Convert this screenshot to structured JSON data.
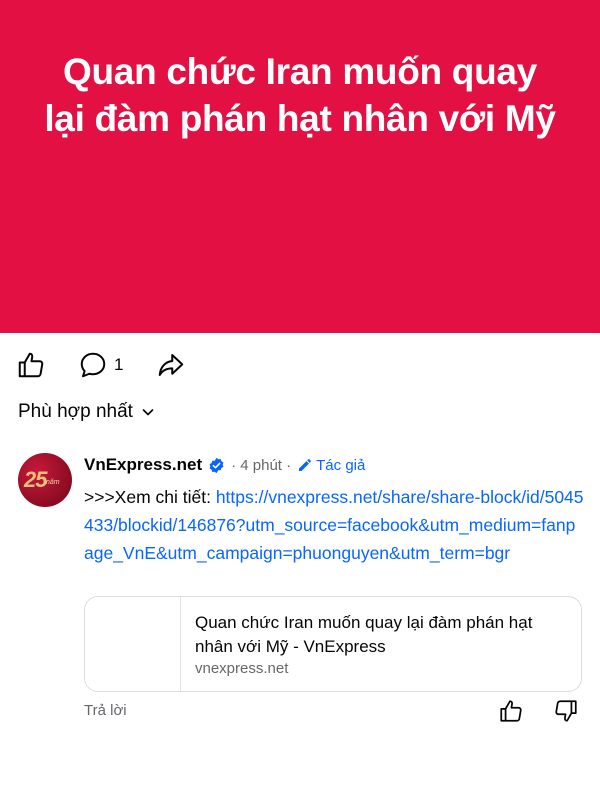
{
  "post": {
    "banner_title": "Quan chức Iran muốn quay lại đàm phán hạt nhân với Mỹ",
    "banner_color": "#e31143"
  },
  "actions": {
    "like_icon": "thumbs-up-icon",
    "comment_icon": "comment-bubble-icon",
    "comment_count": "1",
    "share_icon": "share-arrow-icon"
  },
  "comments_sort": {
    "label": "Phù hợp nhất"
  },
  "comment": {
    "avatar_text": "25",
    "avatar_sub": "năm",
    "author": "VnExpress.net",
    "verified_color": "#0866ff",
    "time": "· 4 phút ·",
    "author_badge": "Tác giả",
    "prefix": ">>>Xem chi tiết: ",
    "link": "https://vnexpress.net/share/share-block/id/5045433/blockid/146876?utm_source=facebook&utm_medium=fanpage_VnE&utm_campaign=phuonguyen&utm_term=bgr",
    "card": {
      "title": "Quan chức Iran muốn quay lại đàm phán hạt nhân với Mỹ - VnExpress",
      "domain": "vnexpress.net"
    },
    "reply_label": "Trả lời"
  },
  "colors": {
    "link": "#0866ff",
    "secondary_text": "#65676b"
  }
}
